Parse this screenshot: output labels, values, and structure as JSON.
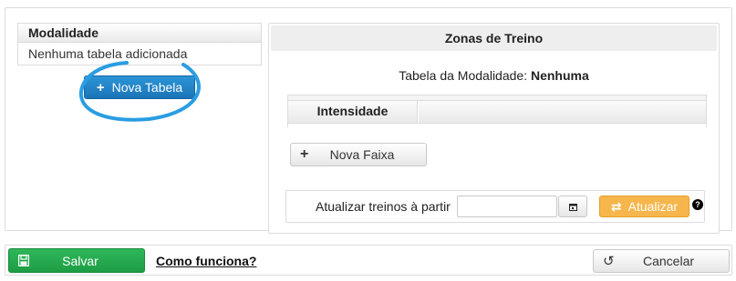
{
  "left_table": {
    "header": "Modalidade",
    "empty_text": "Nenhuma tabela adicionada",
    "new_table_button": "Nova Tabela"
  },
  "zones": {
    "title": "Zonas de Treino",
    "modality_label": "Tabela da Modalidade:",
    "modality_value": "Nenhuma",
    "intensity_header": "Intensidade",
    "new_range_button": "Nova Faixa",
    "update_label": "Atualizar treinos à partir",
    "date_value": "",
    "update_button": "Atualizar",
    "help_symbol": "?"
  },
  "footer": {
    "save_button": "Salvar",
    "help_link": "Como funciona?",
    "cancel_button": "Cancelar"
  },
  "colors": {
    "primary": "#1b74b8",
    "success": "#1e9d44",
    "warning": "#f6b64c",
    "annotation": "#2a9de3"
  },
  "icons": {
    "add": "plus-icon",
    "calendar": "calendar-icon",
    "refresh": "refresh-icon",
    "help": "question-circle-icon",
    "save": "floppy-disk-icon",
    "undo": "undo-icon"
  }
}
